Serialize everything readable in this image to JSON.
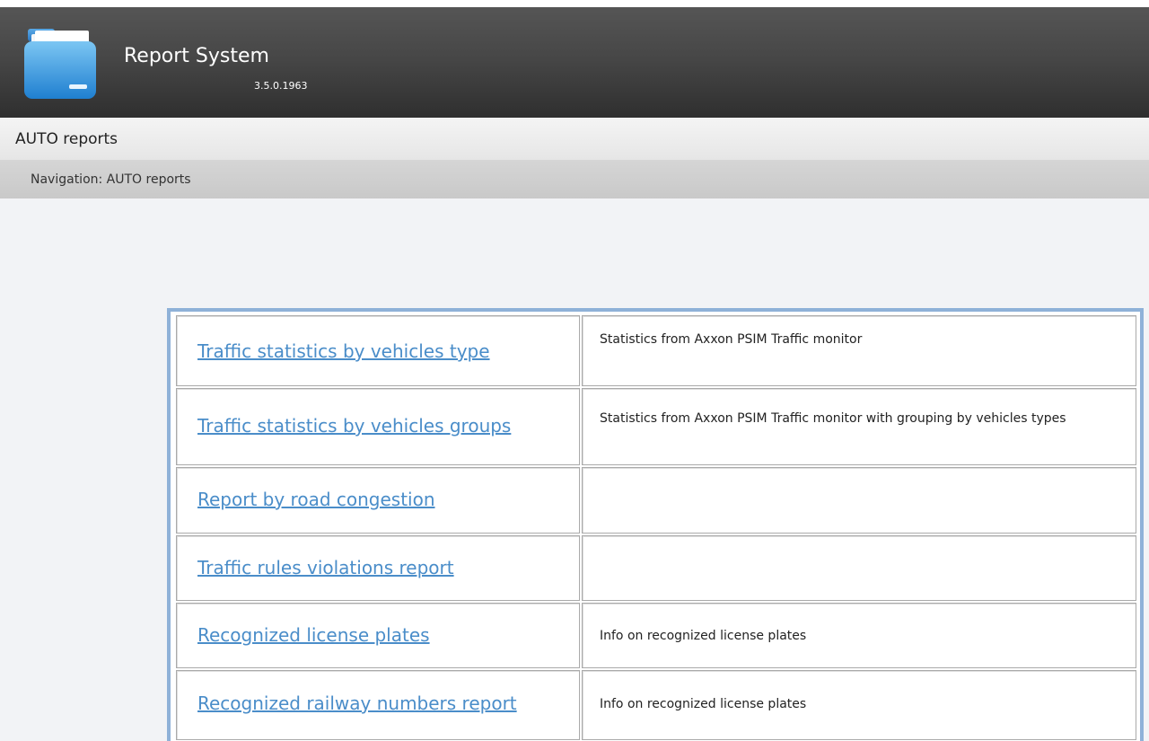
{
  "header": {
    "app_title": "Report System",
    "version": "3.5.0.1963",
    "logo_icon": "folder-icon"
  },
  "section": {
    "title": "AUTO reports"
  },
  "navigation": {
    "text": "Navigation: AUTO reports"
  },
  "reports": [
    {
      "name": "Traffic statistics by vehicles type",
      "description": "Statistics from Axxon PSIM Traffic monitor"
    },
    {
      "name": "Traffic statistics by vehicles groups",
      "description": "Statistics from Axxon PSIM Traffic monitor with grouping by vehicles types"
    },
    {
      "name": "Report by road congestion",
      "description": ""
    },
    {
      "name": "Traffic rules violations report",
      "description": ""
    },
    {
      "name": "Recognized license plates",
      "description": "Info on recognized license plates"
    },
    {
      "name": "Recognized railway numbers report",
      "description": "Info on recognized license plates"
    }
  ],
  "colors": {
    "link": "#4a8dc9",
    "panel_border": "#8fb1d8",
    "header_dark": "#2f2f2f"
  }
}
